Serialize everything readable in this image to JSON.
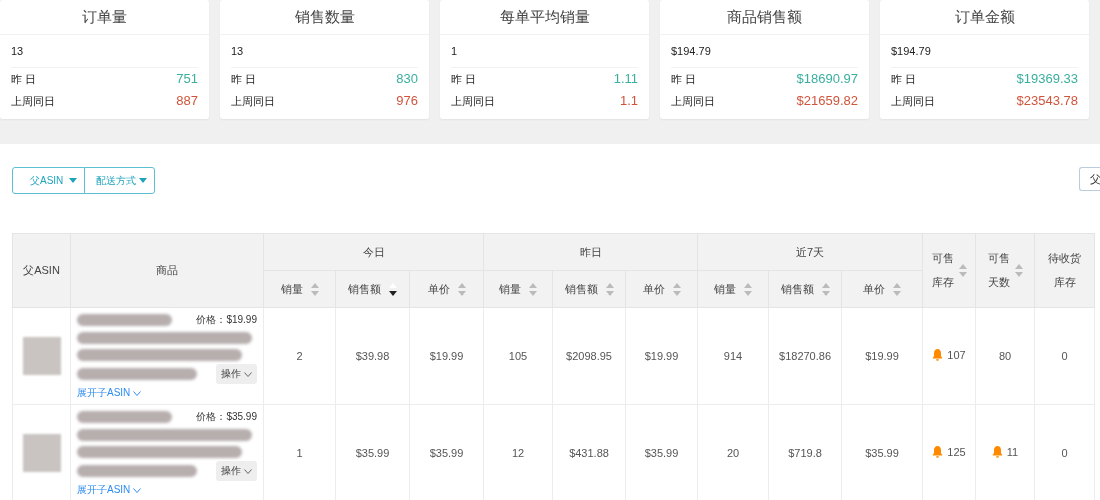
{
  "stat_cards": [
    {
      "title": "订单量",
      "value": "13",
      "rows": [
        {
          "label": "昨 日",
          "value": "751",
          "color": "#3aaf9f"
        },
        {
          "label": "上周同日",
          "value": "887",
          "color": "#d0543c"
        }
      ]
    },
    {
      "title": "销售数量",
      "value": "13",
      "rows": [
        {
          "label": "昨 日",
          "value": "830",
          "color": "#3aaf9f"
        },
        {
          "label": "上周同日",
          "value": "976",
          "color": "#d0543c"
        }
      ]
    },
    {
      "title": "每单平均销量",
      "value": "1",
      "rows": [
        {
          "label": "昨 日",
          "value": "1.11",
          "color": "#3aaf9f"
        },
        {
          "label": "上周同日",
          "value": "1.1",
          "color": "#d0543c"
        }
      ]
    },
    {
      "title": "商品销售额",
      "value": "$194.79",
      "rows": [
        {
          "label": "昨 日",
          "value": "$18690.97",
          "color": "#3aaf9f"
        },
        {
          "label": "上周同日",
          "value": "$21659.82",
          "color": "#d0543c"
        }
      ]
    },
    {
      "title": "订单金额",
      "value": "$194.79",
      "rows": [
        {
          "label": "昨 日",
          "value": "$19369.33",
          "color": "#3aaf9f"
        },
        {
          "label": "上周同日",
          "value": "$23543.78",
          "color": "#d0543c"
        }
      ]
    }
  ],
  "filters": [
    {
      "label": "父ASIN"
    },
    {
      "label": "配送方式"
    }
  ],
  "right_button": {
    "label": "父"
  },
  "table": {
    "lead_columns": [
      "父ASIN",
      "商品"
    ],
    "groups": [
      {
        "label": "今日",
        "columns": [
          {
            "label": "销量",
            "sorted": false
          },
          {
            "label": "销售额",
            "sorted": true
          },
          {
            "label": "单价",
            "sorted": false
          }
        ]
      },
      {
        "label": "昨日",
        "columns": [
          {
            "label": "销量",
            "sorted": false
          },
          {
            "label": "销售额",
            "sorted": false
          },
          {
            "label": "单价",
            "sorted": false
          }
        ]
      },
      {
        "label": "近7天",
        "columns": [
          {
            "label": "销量",
            "sorted": false
          },
          {
            "label": "销售额",
            "sorted": false
          },
          {
            "label": "单价",
            "sorted": false
          }
        ]
      }
    ],
    "tail_columns": [
      {
        "lines": [
          "可售",
          "库存"
        ],
        "sortable": true
      },
      {
        "lines": [
          "可售",
          "天数"
        ],
        "sortable": true
      },
      {
        "lines": [
          "待收货",
          "库存"
        ],
        "sortable": false
      }
    ],
    "rows": [
      {
        "price": "价格：$19.99",
        "action": "操作",
        "expand": "展开子ASIN",
        "values": [
          "2",
          "$39.98",
          "$19.99",
          "105",
          "$2098.95",
          "$19.99",
          "914",
          "$18270.86",
          "$19.99"
        ],
        "tail": [
          {
            "value": "107",
            "alert": true
          },
          {
            "value": "80",
            "alert": false
          },
          {
            "value": "0",
            "alert": false
          }
        ]
      },
      {
        "price": "价格：$35.99",
        "action": "操作",
        "expand": "展开子ASIN",
        "values": [
          "1",
          "$35.99",
          "$35.99",
          "12",
          "$431.88",
          "$35.99",
          "20",
          "$719.8",
          "$35.99"
        ],
        "tail": [
          {
            "value": "125",
            "alert": true
          },
          {
            "value": "11",
            "alert": true
          },
          {
            "value": "0",
            "alert": false
          }
        ]
      }
    ]
  }
}
